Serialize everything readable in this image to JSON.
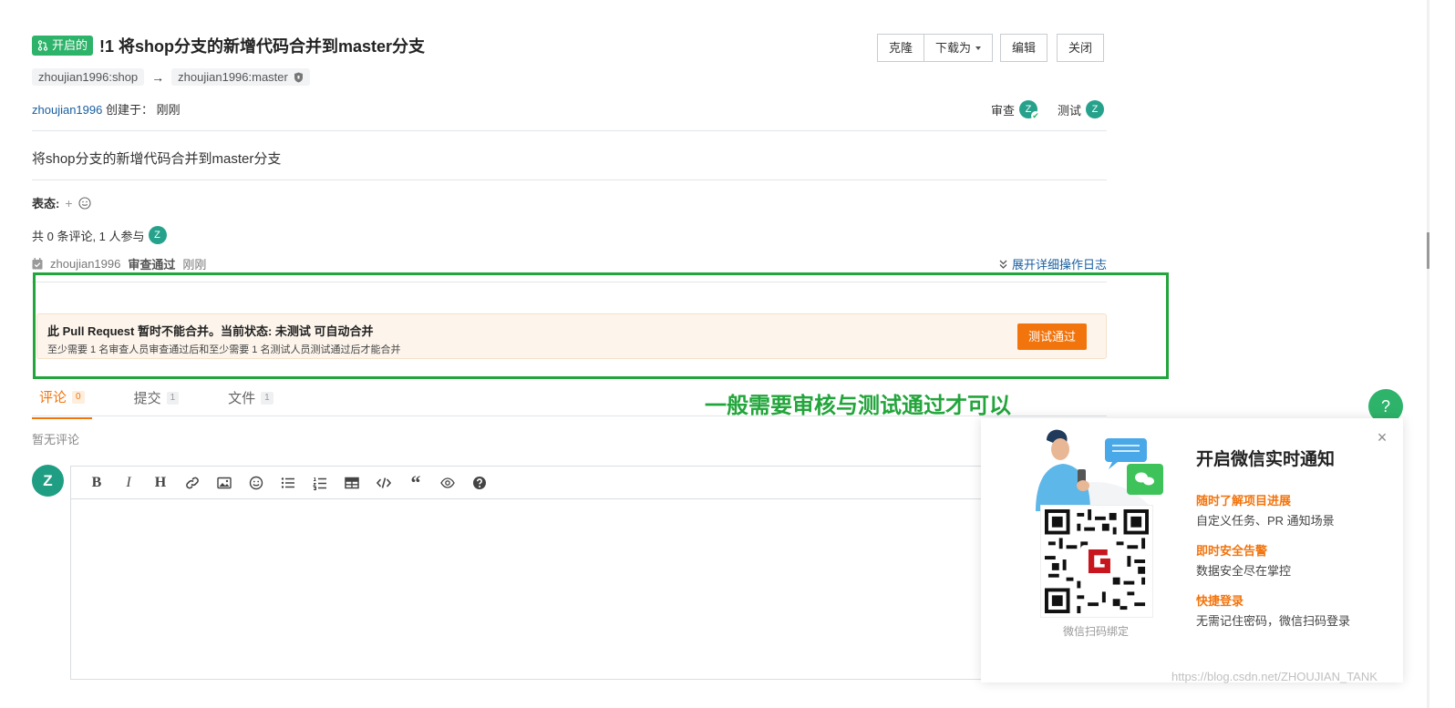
{
  "header": {
    "status": "开启的",
    "title": "!1 将shop分支的新增代码合并到master分支",
    "source_branch": "zhoujian1996:shop",
    "arrow": "→",
    "target_branch": "zhoujian1996:master",
    "author": "zhoujian1996",
    "created_label": " 创建于：",
    "created_time": "刚刚",
    "buttons": {
      "clone": "克隆",
      "download": "下载为",
      "edit": "编辑",
      "close": "关闭"
    },
    "reviewer_label": "审查",
    "tester_label": "测试",
    "avatar_letter": "Z"
  },
  "body": {
    "description": "将shop分支的新增代码合并到master分支",
    "reaction_label": "表态:",
    "comments_summary": "共 0 条评论, 1 人参与",
    "log": {
      "user": "zhoujian1996",
      "action": "审查通过",
      "time": "刚刚"
    },
    "expand_log": "展开详细操作日志"
  },
  "merge_status": {
    "title": "此 Pull Request 暂时不能合并。当前状态: 未测试 可自动合并",
    "subtitle": "至少需要 1 名审查人员审查通过后和至少需要 1 名测试人员测试通过后才能合并",
    "button": "测试通过"
  },
  "annotation": "一般需要审核与测试通过才可以",
  "tabs": [
    {
      "label": "评论",
      "count": "0"
    },
    {
      "label": "提交",
      "count": "1"
    },
    {
      "label": "文件",
      "count": "1"
    }
  ],
  "comments": {
    "empty": "暂无评论",
    "avatar_letter": "Z"
  },
  "wechat_popup": {
    "title": "开启微信实时通知",
    "features": [
      {
        "title": "随时了解项目进展",
        "desc": "自定义任务、PR 通知场景"
      },
      {
        "title": "即时安全告警",
        "desc": "数据安全尽在掌控"
      },
      {
        "title": "快捷登录",
        "desc": "无需记住密码，微信扫码登录"
      }
    ],
    "qr_caption": "微信扫码绑定",
    "close": "×"
  },
  "help": "?",
  "watermark": "https://blog.csdn.net/ZHOUJIAN_TANK",
  "colors": {
    "brand_green": "#2eb36a",
    "accent_orange": "#f2740d",
    "annotation_green": "#22a53b",
    "link_blue": "#1a5fa0"
  }
}
